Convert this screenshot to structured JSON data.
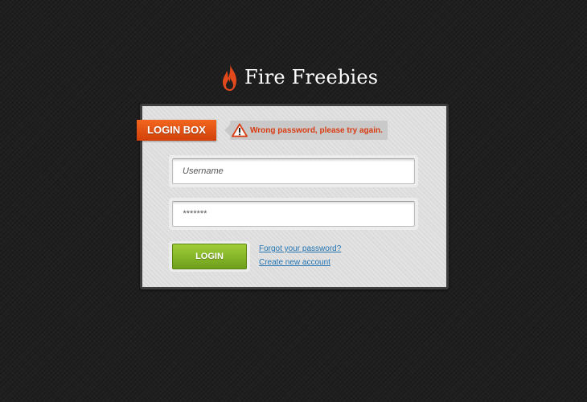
{
  "brand": {
    "name": "Fire Freebies",
    "icon": "flame-icon",
    "icon_color": "#e2491c"
  },
  "login_box": {
    "ribbon_label": "LOGIN BOX",
    "ribbon_color": "#e8561a",
    "error": {
      "icon": "warning-icon",
      "message": "Wrong password, please try again.",
      "color": "#d93b12"
    },
    "username": {
      "value": "",
      "placeholder": "Username"
    },
    "password": {
      "value": "*******",
      "placeholder": ""
    },
    "login_button_label": "LOGIN",
    "login_button_color": "#8dbd2c",
    "forgot_link": "Forgot your password?",
    "create_link": "Create new account",
    "link_color": "#2474b2"
  }
}
